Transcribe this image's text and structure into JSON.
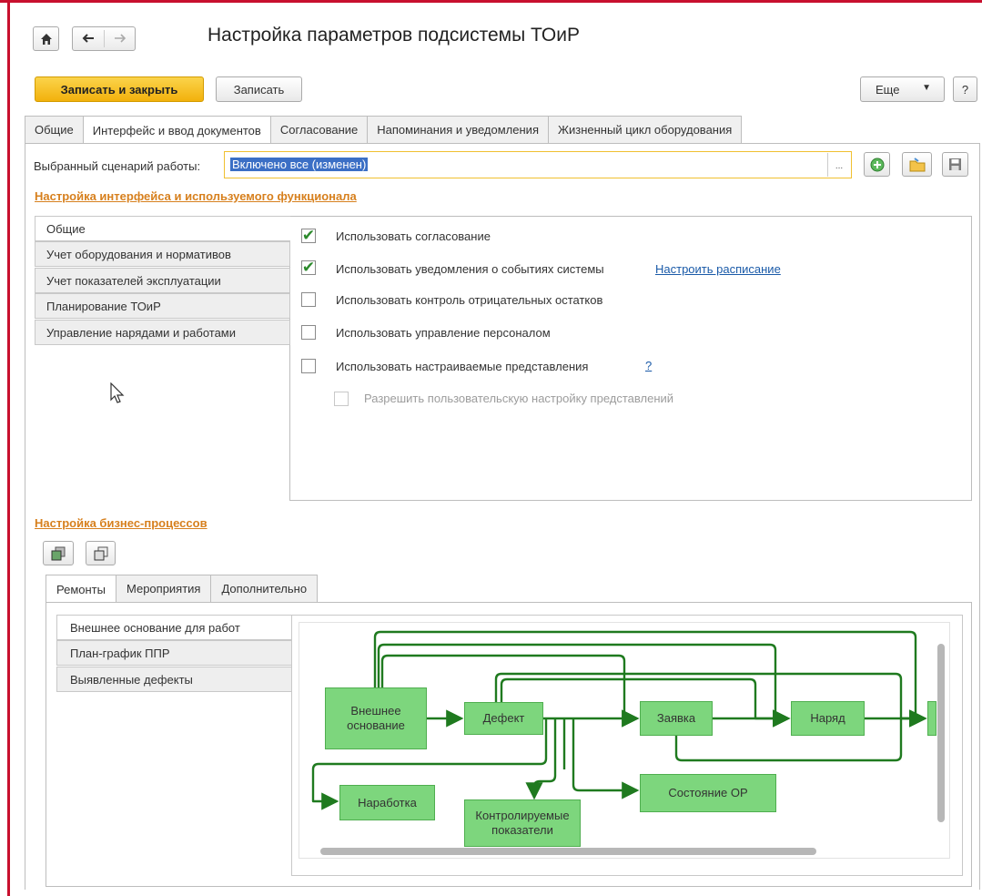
{
  "window": {
    "title": "Настройка параметров подсистемы ТОиР"
  },
  "nav": {
    "home_icon": "home-icon",
    "back_icon": "arrow-left-icon",
    "forward_icon": "arrow-right-icon"
  },
  "toolbar": {
    "save_close_label": "Записать и закрыть",
    "save_label": "Записать",
    "more_label": "Еще",
    "help_label": "?"
  },
  "tabs": [
    "Общие",
    "Интерфейс и ввод документов",
    "Согласование",
    "Напоминания и уведомления",
    "Жизненный цикл оборудования"
  ],
  "active_tab": 1,
  "scenario": {
    "label": "Выбранный сценарий работы:",
    "value": "Включено все (изменен)",
    "select_button": "..."
  },
  "interface_section": {
    "title": "Настройка интерфейса и используемого функционала",
    "menu": [
      "Общие",
      "Учет оборудования и нормативов",
      "Учет показателей эксплуатации",
      "Планирование ТОиР",
      "Управление нарядами и работами"
    ],
    "options": [
      {
        "label": "Использовать согласование",
        "checked": true
      },
      {
        "label": "Использовать уведомления о событиях системы",
        "checked": true,
        "link": "Настроить расписание"
      },
      {
        "label": "Использовать контроль отрицательных остатков",
        "checked": false
      },
      {
        "label": "Использовать управление персоналом",
        "checked": false
      },
      {
        "label": "Использовать настраиваемые представления",
        "checked": false,
        "link": "?"
      },
      {
        "label": "Разрешить пользовательскую настройку представлений",
        "checked": false,
        "disabled": true
      }
    ]
  },
  "bp_section": {
    "title": "Настройка бизнес-процессов",
    "tabs": [
      "Ремонты",
      "Мероприятия",
      "Дополнительно"
    ],
    "menu": [
      "Внешнее основание для работ",
      "План-график ППР",
      "Выявленные дефекты"
    ],
    "nodes": {
      "external": "Внешнее основание",
      "defect": "Дефект",
      "request": "Заявка",
      "order": "Наряд",
      "operating": "Наработка",
      "indicators": "Контролируемые показатели",
      "state": "Состояние ОР"
    }
  },
  "colors": {
    "accent": "#f2b10c",
    "node_fill": "#7dd67d",
    "arrow": "#1f7a1f",
    "section_title": "#d7801e",
    "frame": "#c8102e"
  }
}
